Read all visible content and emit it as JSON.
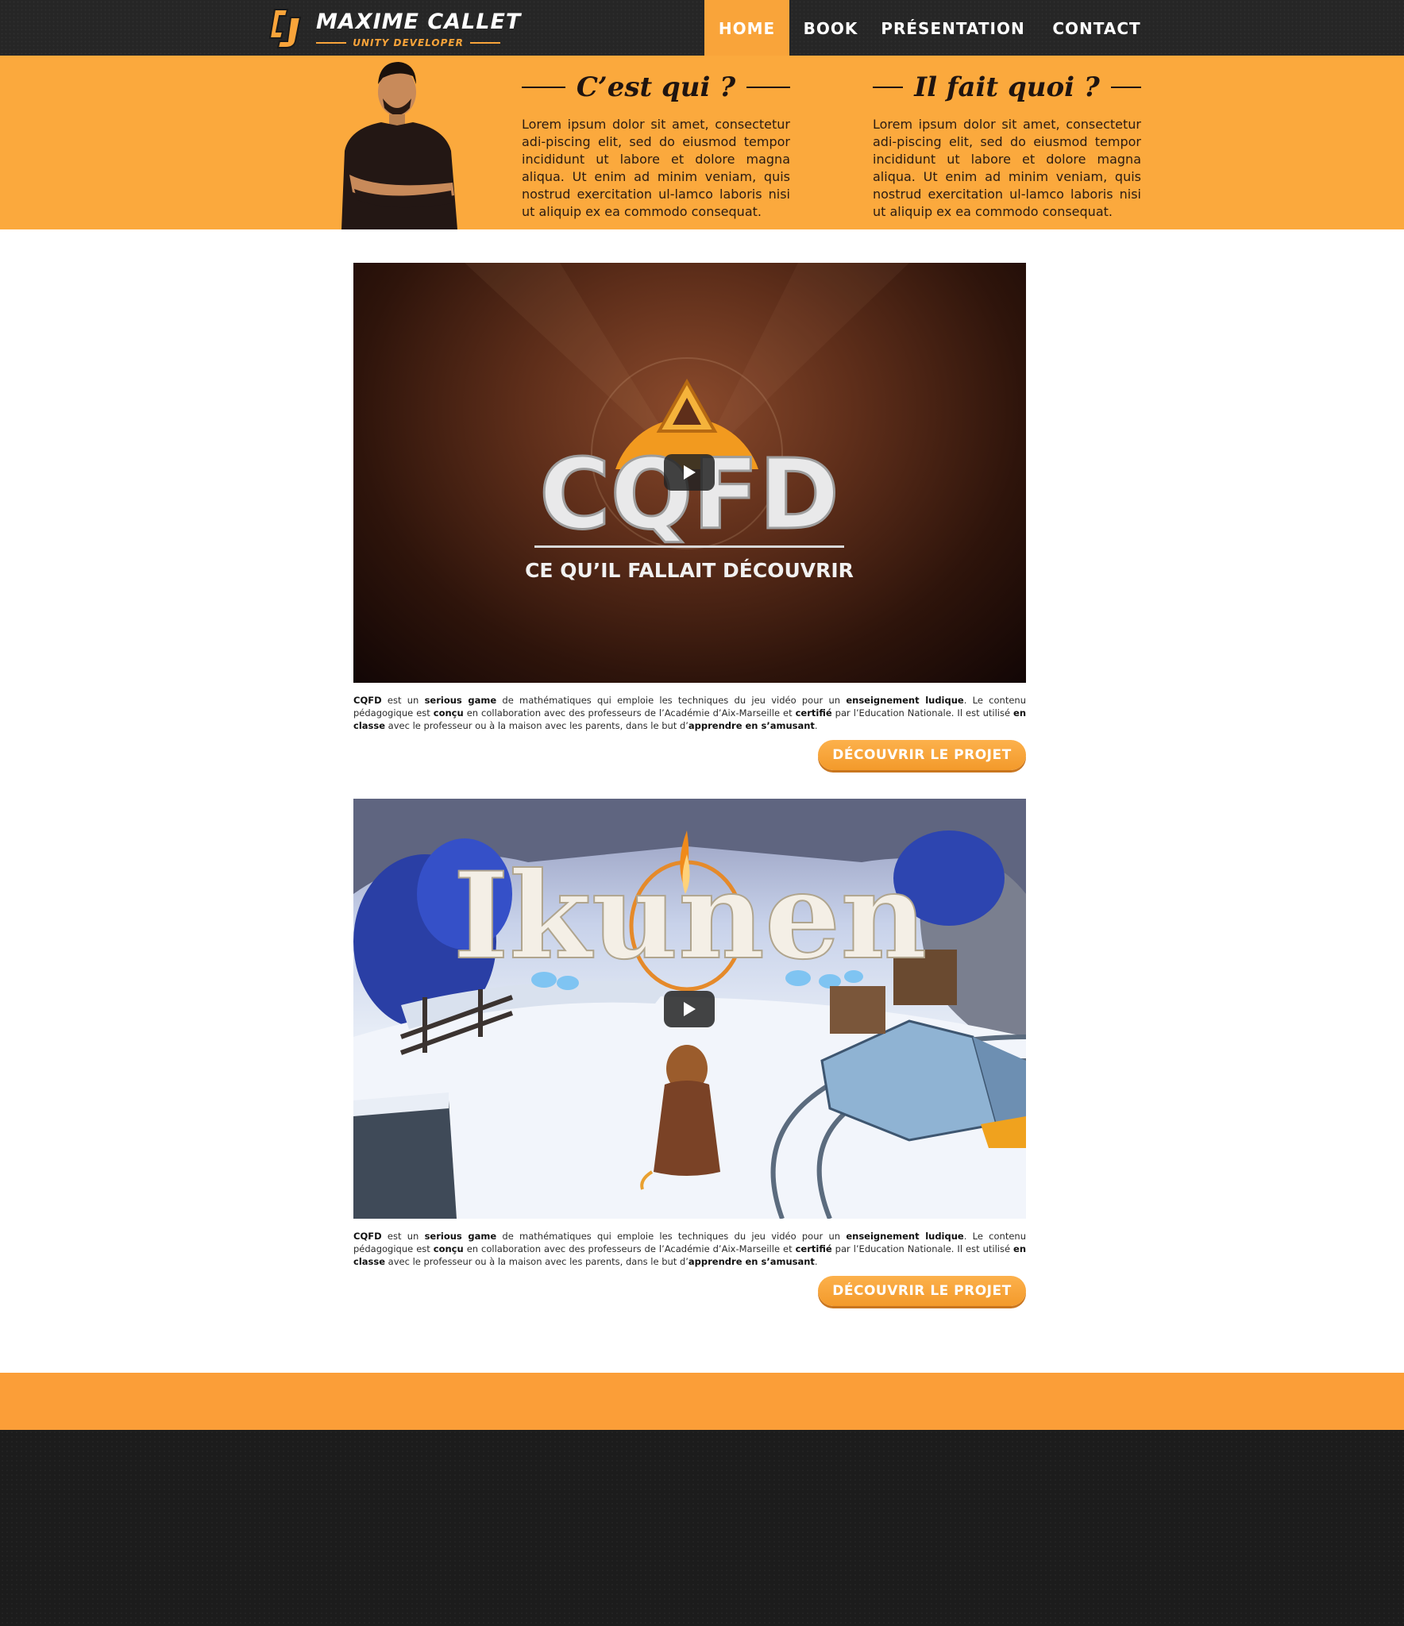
{
  "brand": {
    "name": "MAXIME CALLET",
    "tagline": "UNITY DEVELOPER",
    "logo_icon": "cj-monogram-icon",
    "accent": "#f9a43a"
  },
  "nav": {
    "items": [
      {
        "label": "HOME",
        "active": true
      },
      {
        "label": "BOOK",
        "active": false
      },
      {
        "label": "PRÉSENTATION",
        "active": false
      },
      {
        "label": "CONTACT",
        "active": false
      }
    ]
  },
  "hero": {
    "background": "#fba93d",
    "columns": [
      {
        "title": "C’est qui ?",
        "text": "Lorem ipsum dolor sit amet, consectetur adi-piscing elit, sed do eiusmod tempor incididunt ut labore et dolore magna aliqua. Ut enim ad minim veniam, quis nostrud exercitation ul-lamco laboris nisi ut aliquip ex ea commodo consequat."
      },
      {
        "title": "Il fait quoi ?",
        "text": "Lorem ipsum dolor sit amet, consectetur adi-piscing elit, sed do eiusmod tempor incididunt ut labore et dolore magna aliqua. Ut enim ad minim veniam, quis nostrud exercitation ul-lamco laboris nisi ut aliquip ex ea commodo consequat."
      }
    ]
  },
  "projects": [
    {
      "thumb_title": "CQFD",
      "thumb_subtitle": "CE QU’IL FALLAIT DÉCOUVRIR",
      "desc": {
        "p1": "CQFD",
        "t1": " est un ",
        "p2": "serious game",
        "t2": " de mathématiques qui emploie les techniques du jeu vidéo pour un ",
        "p3": "enseignement ludique",
        "t3": ". Le contenu pédagogique est ",
        "p4": "conçu",
        "t4": " en collaboration avec des professeurs de l’Académie d’Aix-Marseille et ",
        "p5": "certifié",
        "t5": " par l’Education Nationale. Il est utilisé ",
        "p6": "en classe",
        "t6": " avec le professeur ou à la maison avec les parents, dans le but d’",
        "p7": "apprendre en s’amusant",
        "t7": "."
      },
      "button": "DÉCOUVRIR LE PROJET"
    },
    {
      "thumb_title": "Ikunen",
      "desc": {
        "p1": "CQFD",
        "t1": " est un ",
        "p2": "serious game",
        "t2": " de mathématiques qui emploie les techniques du jeu vidéo pour un ",
        "p3": "enseignement ludique",
        "t3": ". Le contenu pédagogique est ",
        "p4": "conçu",
        "t4": " en collaboration avec des professeurs de l’Académie d’Aix-Marseille et ",
        "p5": "certifié",
        "t5": " par l’Education Nationale. Il est utilisé ",
        "p6": "en classe",
        "t6": " avec le professeur ou à la maison avec les parents, dans le but d’",
        "p7": "apprendre en s’amusant",
        "t7": "."
      },
      "button": "DÉCOUVRIR LE PROJET"
    }
  ],
  "icons": {
    "play": "play-icon"
  }
}
